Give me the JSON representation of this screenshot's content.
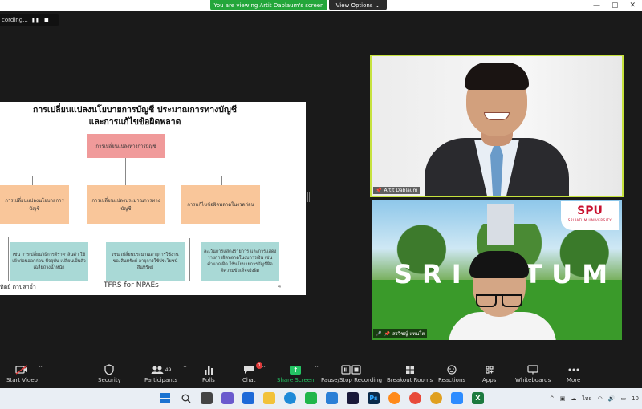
{
  "banner": {
    "viewing": "You are viewing Artit Dablaum's screen",
    "view_options": "View Options",
    "view_options_caret": "⌄"
  },
  "window_controls": {
    "minimize": "—",
    "maximize": "▢",
    "close": "✕"
  },
  "recording": {
    "label": "cording...",
    "pause": "❚❚",
    "stop": "■"
  },
  "slide": {
    "title_line1": "การเปลี่ยนแปลงนโยบายการบัญชี ประมาณการทางบัญชี",
    "title_line2": "และการแก้ไขข้อผิดพลาด",
    "root_box": "การเปลี่ยนแปลงทางการบัญชี",
    "mid_boxes": [
      "การเปลี่ยนแปลงนโยบายการบัญชี",
      "การเปลี่ยนแปลงประมาณการทางบัญชี",
      "การแก้ไขข้อผิดพลาดในงวดก่อน"
    ],
    "leaf_boxes": [
      "เช่น การเปลี่ยนวิธีการตีราคาสินค้า ใช้เข้าก่อนออกก่อน ปัจจุบัน เปลี่ยนเป็นถัวเฉลี่ยถ่วงน้ำหนัก",
      "เช่น เปลี่ยนประมาณอายุการใช้งานของสินทรัพย์ อายุการใช้ประโยชน์สินทรัพย์",
      "ละเว้นการแสดงรายการ และการแสดงรายการผิดพลาดในงบการเงิน เช่น คำนวณผิด ใช้นโยบายการบัญชีผิด ตีความข้อเท็จจริงผิด"
    ],
    "footer_left": "ทิตย์ ดาบลาอ่ำ",
    "footer_mid": "TFRS for NPAEs",
    "page_number": "4"
  },
  "tiles": [
    {
      "name": "Artit Dablaum"
    },
    {
      "name": "สรวิชญ์ แหนโต",
      "logo_title": "SPU",
      "logo_sub": "SRIPATUM UNIVERSITY",
      "bg_text": "SRIPATUM"
    }
  ],
  "toolbar": {
    "start_video": "Start Video",
    "security": "Security",
    "participants": "Participants",
    "participants_count": "49",
    "polls": "Polls",
    "chat": "Chat",
    "chat_badge": "1",
    "share_screen": "Share Screen",
    "pause_stop_recording": "Pause/Stop Recording",
    "breakout_rooms": "Breakout Rooms",
    "reactions": "Reactions",
    "apps": "Apps",
    "whiteboards": "Whiteboards",
    "more": "More",
    "caret": "^"
  },
  "taskbar": {
    "lang": "ไทย",
    "time": "10",
    "tray_caret": "^"
  },
  "colors": {
    "accent_green": "#23a63a",
    "active_speaker": "#c6e23e",
    "share_green": "#23c463",
    "root_box": "#f09a9a",
    "mid_box": "#f9c69a",
    "leaf_box": "#a9d9d6"
  }
}
